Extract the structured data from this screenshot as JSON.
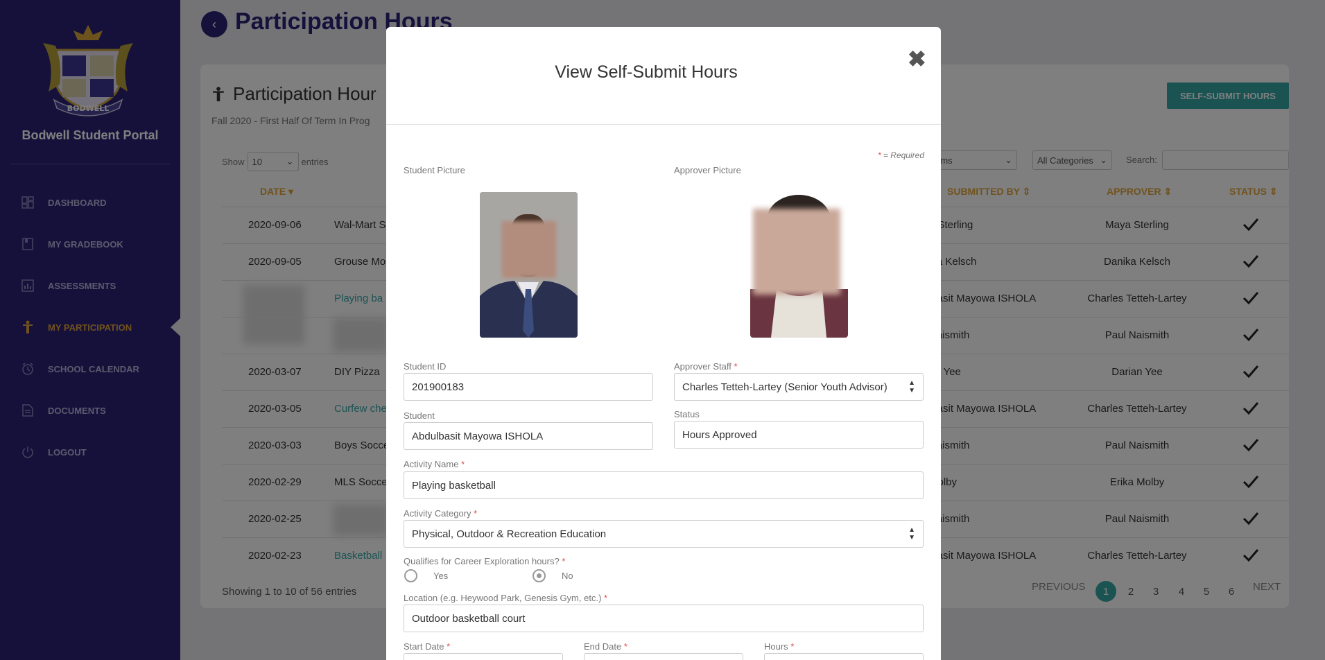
{
  "sidebar": {
    "portal_title": "Bodwell Student Portal",
    "logo_text": "BODWELL",
    "items": [
      {
        "label": "DASHBOARD",
        "icon": "dashboard-icon"
      },
      {
        "label": "MY GRADEBOOK",
        "icon": "gradebook-icon"
      },
      {
        "label": "ASSESSMENTS",
        "icon": "assessments-icon"
      },
      {
        "label": "MY PARTICIPATION",
        "icon": "participation-icon",
        "active": true
      },
      {
        "label": "SCHOOL CALENDAR",
        "icon": "calendar-icon"
      },
      {
        "label": "DOCUMENTS",
        "icon": "documents-icon"
      },
      {
        "label": "LOGOUT",
        "icon": "logout-icon"
      }
    ]
  },
  "page": {
    "title": "Participation Hours",
    "card_title": "Participation Hour",
    "term": "Fall 2020 - First Half Of Term In Prog",
    "self_submit_label": "SELF-SUBMIT HOURS",
    "show_label": "Show",
    "show_value": "10",
    "entries_label": "entries",
    "filter_terms": "rms",
    "filter_categories": "All Categories",
    "search_label": "Search:"
  },
  "table": {
    "headers": {
      "date": "DATE",
      "submitted_by": "SUBMITTED BY",
      "approver": "APPROVER",
      "status": "STATUS"
    },
    "rows": [
      {
        "date": "2020-09-06",
        "activity": "Wal-Mart S",
        "link": false,
        "submitted_by": "a Sterling",
        "approver": "Maya Sterling"
      },
      {
        "date": "2020-09-05",
        "activity": "Grouse Mo",
        "link": false,
        "submitted_by": "ika Kelsch",
        "approver": "Danika Kelsch"
      },
      {
        "date": "",
        "activity": "Playing ba",
        "link": true,
        "submitted_by": "lbasit Mayowa ISHOLA",
        "approver": "Charles Tetteh-Lartey"
      },
      {
        "date": "",
        "activity": "",
        "link": false,
        "submitted_by": "Naismith",
        "approver": "Paul Naismith"
      },
      {
        "date": "2020-03-07",
        "activity": "DIY Pizza",
        "link": false,
        "submitted_by": "an Yee",
        "approver": "Darian Yee"
      },
      {
        "date": "2020-03-05",
        "activity": "Curfew che",
        "link": true,
        "submitted_by": "lbasit Mayowa ISHOLA",
        "approver": "Charles Tetteh-Lartey"
      },
      {
        "date": "2020-03-03",
        "activity": "Boys Socce",
        "link": false,
        "submitted_by": "Naismith",
        "approver": "Paul Naismith"
      },
      {
        "date": "2020-02-29",
        "activity": "MLS Socce",
        "link": false,
        "submitted_by": "Molby",
        "approver": "Erika Molby"
      },
      {
        "date": "2020-02-25",
        "activity": "",
        "link": false,
        "submitted_by": "Naismith",
        "approver": "Paul Naismith"
      },
      {
        "date": "2020-02-23",
        "activity": "Basketball",
        "link": true,
        "submitted_by": "lbasit Mayowa ISHOLA",
        "approver": "Charles Tetteh-Lartey"
      }
    ],
    "status_icon": "checkmark-icon",
    "footer_info": "Showing 1 to 10 of 56 entries",
    "pagination": {
      "previous": "PREVIOUS",
      "pages": [
        "1",
        "2",
        "3",
        "4",
        "5",
        "6"
      ],
      "next": "NEXT",
      "current": "1"
    }
  },
  "modal": {
    "title": "View Self-Submit Hours",
    "close_icon": "close-icon",
    "required_note": "= Required",
    "required_star": "*",
    "student_picture_label": "Student Picture",
    "approver_picture_label": "Approver Picture",
    "student_id_label": "Student ID",
    "student_id": "201900183",
    "approver_staff_label": "Approver Staff",
    "approver_staff": "Charles Tetteh-Lartey (Senior Youth Advisor)",
    "student_label": "Student",
    "student": "Abdulbasit Mayowa ISHOLA",
    "status_label": "Status",
    "status": "Hours Approved",
    "activity_name_label": "Activity Name",
    "activity_name": "Playing basketball",
    "activity_category_label": "Activity Category",
    "activity_category": "Physical, Outdoor & Recreation Education",
    "career_label": "Qualifies for Career Exploration hours?",
    "career_yes": "Yes",
    "career_no": "No",
    "career_selected": "No",
    "location_label": "Location (e.g. Heywood Park, Genesis Gym, etc.)",
    "location": "Outdoor basketball court",
    "start_date_label": "Start Date",
    "end_date_label": "End Date",
    "hours_label": "Hours"
  },
  "colors": {
    "brand": "#2a2276",
    "accent": "#e2a43a",
    "teal": "#36a6a6",
    "required": "#d9534f"
  }
}
